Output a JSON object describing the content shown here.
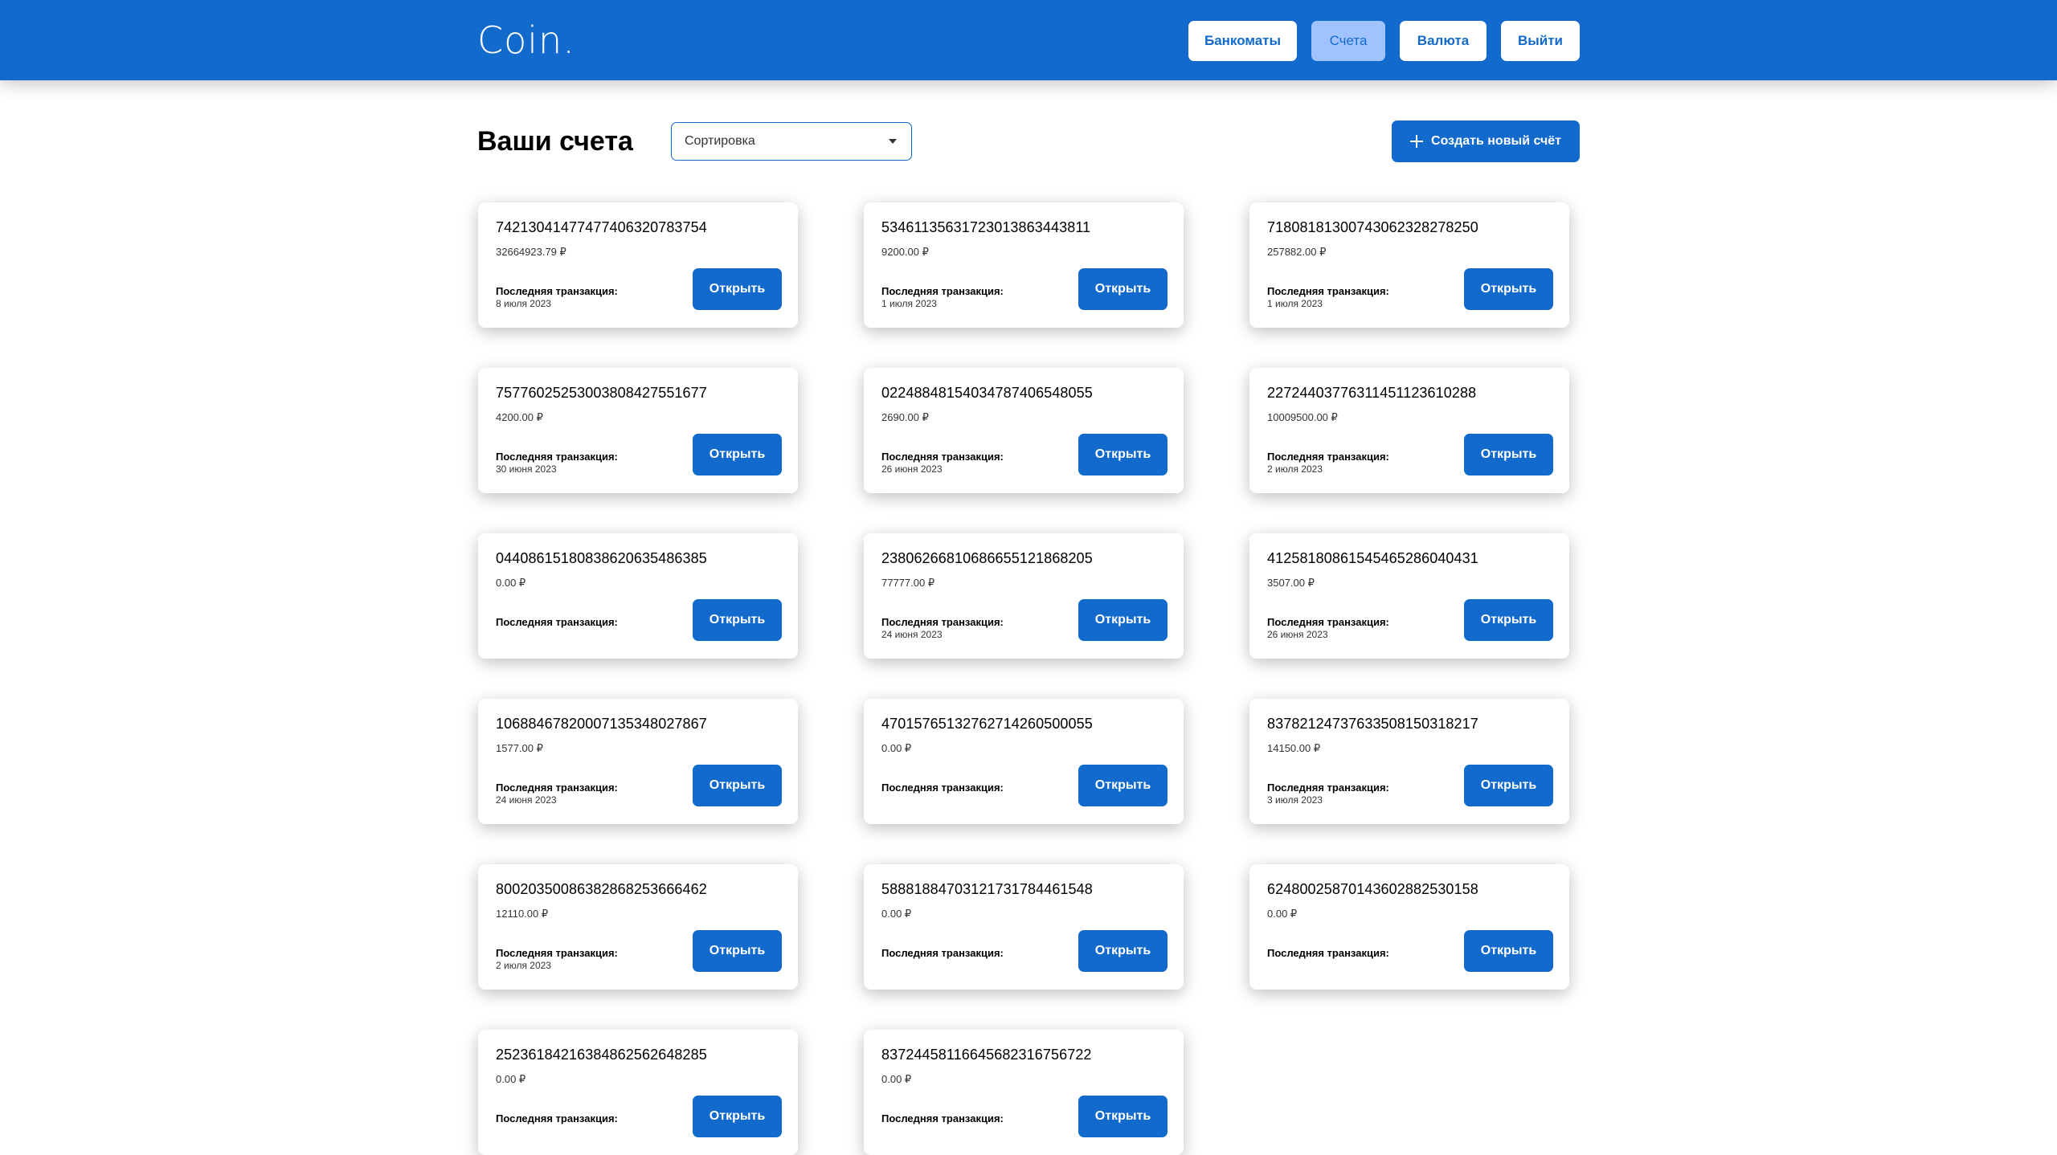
{
  "header": {
    "logo": "Coin.",
    "nav": [
      "Банкоматы",
      "Счета",
      "Валюта",
      "Выйти"
    ]
  },
  "toolbar": {
    "title": "Ваши счета",
    "sort_placeholder": "Сортировка",
    "create_label": "Создать новый счёт"
  },
  "card_labels": {
    "last_tx": "Последняя транзакция:",
    "open": "Открыть"
  },
  "accounts": [
    {
      "number": "74213041477477406320783754",
      "balance": "32664923.79 ₽",
      "date": "8 июля 2023"
    },
    {
      "number": "53461135631723013863443811",
      "balance": "9200.00 ₽",
      "date": "1 июля 2023"
    },
    {
      "number": "71808181300743062328278250",
      "balance": "257882.00 ₽",
      "date": "1 июля 2023"
    },
    {
      "number": "75776025253003808427551677",
      "balance": "4200.00 ₽",
      "date": "30 июня 2023"
    },
    {
      "number": "02248848154034787406548055",
      "balance": "2690.00 ₽",
      "date": "26 июня 2023"
    },
    {
      "number": "22724403776311451123610288",
      "balance": "10009500.00 ₽",
      "date": "2 июля 2023"
    },
    {
      "number": "04408615180838620635486385",
      "balance": "0.00 ₽",
      "date": ""
    },
    {
      "number": "23806266810686655121868205",
      "balance": "77777.00 ₽",
      "date": "24 июня 2023"
    },
    {
      "number": "41258180861545465286040431",
      "balance": "3507.00 ₽",
      "date": "26 июня 2023"
    },
    {
      "number": "10688467820007135348027867",
      "balance": "1577.00 ₽",
      "date": "24 июня 2023"
    },
    {
      "number": "47015765132762714260500055",
      "balance": "0.00 ₽",
      "date": ""
    },
    {
      "number": "83782124737633508150318217",
      "balance": "14150.00 ₽",
      "date": "3 июля 2023"
    },
    {
      "number": "80020350086382868253666462",
      "balance": "12110.00 ₽",
      "date": "2 июля 2023"
    },
    {
      "number": "58881884703121731784461548",
      "balance": "0.00 ₽",
      "date": ""
    },
    {
      "number": "62480025870143602882530158",
      "balance": "0.00 ₽",
      "date": ""
    },
    {
      "number": "25236184216384862562648285",
      "balance": "0.00 ₽",
      "date": ""
    },
    {
      "number": "83724458116645682316756722",
      "balance": "0.00 ₽",
      "date": ""
    }
  ]
}
